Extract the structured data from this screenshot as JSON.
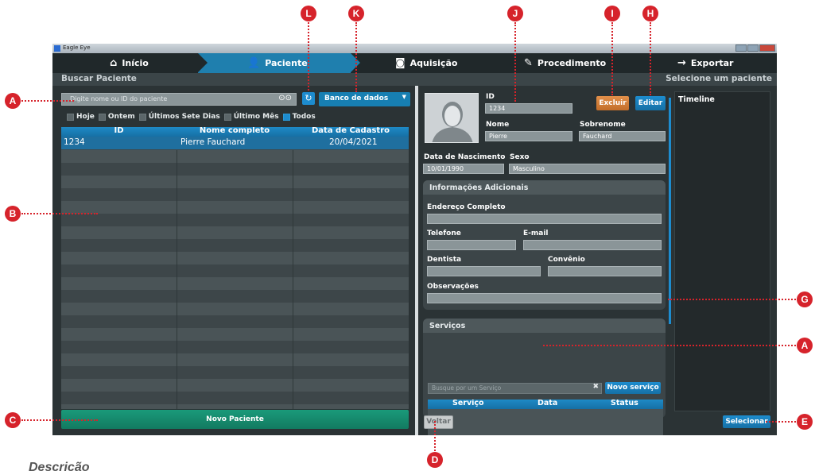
{
  "window": {
    "title": "Eagle Eye"
  },
  "nav": {
    "items": [
      {
        "label": "Início",
        "icon": "home-icon"
      },
      {
        "label": "Paciente",
        "icon": "user-icon"
      },
      {
        "label": "Aquisição",
        "icon": "camera-icon"
      },
      {
        "label": "Procedimento",
        "icon": "edit-icon"
      },
      {
        "label": "Exportar",
        "icon": "export-icon"
      }
    ],
    "active": "Paciente"
  },
  "subheader": {
    "left": "Buscar Paciente",
    "right": "Selecione um paciente"
  },
  "search": {
    "placeholder": "Digite nome ou ID do paciente",
    "database": "Banco de dados",
    "filters": [
      {
        "label": "Hoje",
        "checked": false
      },
      {
        "label": "Ontem",
        "checked": false
      },
      {
        "label": "Últimos Sete Dias",
        "checked": false
      },
      {
        "label": "Último Mês",
        "checked": false
      },
      {
        "label": "Todos",
        "checked": true
      }
    ]
  },
  "patients_table": {
    "columns": [
      "ID",
      "Nome completo",
      "Data de Cadastro"
    ],
    "rows": [
      [
        "1234",
        "Pierre Fauchard",
        "20/04/2021"
      ]
    ]
  },
  "new_patient_label": "Novo Paciente",
  "patient": {
    "id_label": "ID",
    "id": "1234",
    "name_label": "Nome",
    "name": "Pierre",
    "surname_label": "Sobrenome",
    "surname": "Fauchard",
    "birth_label": "Data de Nascimento",
    "birth": "10/01/1990",
    "sex_label": "Sexo",
    "sex": "Masculino"
  },
  "buttons": {
    "delete": "Excluir",
    "edit": "Editar",
    "back": "Voltar",
    "select": "Selecionar",
    "new_service": "Novo serviço"
  },
  "additional": {
    "title": "Informações Adicionais",
    "address_label": "Endereço Completo",
    "phone_label": "Telefone",
    "email_label": "E-mail",
    "dentist_label": "Dentista",
    "insurance_label": "Convênio",
    "notes_label": "Observações"
  },
  "services": {
    "title": "Serviços",
    "placeholder": "Busque por um Serviço",
    "columns": [
      "Serviço",
      "Data",
      "Status"
    ]
  },
  "timeline": {
    "title": "Timeline"
  },
  "callouts": [
    "A",
    "B",
    "C",
    "D",
    "E",
    "G",
    "A",
    "H",
    "I",
    "J",
    "K",
    "L"
  ],
  "footer_text": "Descrição",
  "colors": {
    "accent": "#1d8ccf",
    "danger": "#c26d2a",
    "green": "#1a9a7a",
    "marker": "#d6232b"
  }
}
